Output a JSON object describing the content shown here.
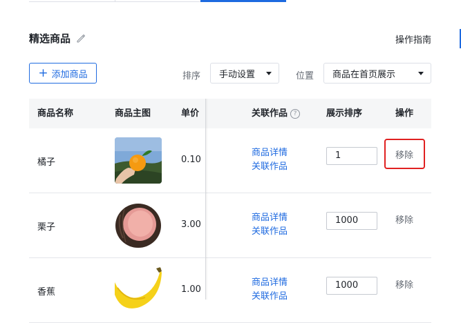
{
  "header": {
    "section_title": "精选商品",
    "guide_link": "操作指南",
    "add_button_label": "添加商品",
    "sort_label": "排序",
    "sort_value": "手动设置",
    "position_label": "位置",
    "position_value": "商品在首页展示"
  },
  "table": {
    "columns": [
      "商品名称",
      "商品主图",
      "单价",
      "关联作品",
      "展示排序",
      "操作"
    ],
    "rows": [
      {
        "name": "橘子",
        "image": "orange-photo",
        "price": "0.10",
        "link_detail": "商品详情",
        "link_related": "关联作品",
        "order": "1",
        "action": "移除"
      },
      {
        "name": "栗子",
        "image": "chestnut-photo",
        "price": "3.00",
        "link_detail": "商品详情",
        "link_related": "关联作品",
        "order": "1000",
        "action": "移除"
      },
      {
        "name": "香蕉",
        "image": "banana-photo",
        "price": "1.00",
        "link_detail": "商品详情",
        "link_related": "关联作品",
        "order": "1000",
        "action": "移除"
      }
    ]
  },
  "colors": {
    "accent": "#1e6ae0",
    "highlight": "#e02020"
  }
}
